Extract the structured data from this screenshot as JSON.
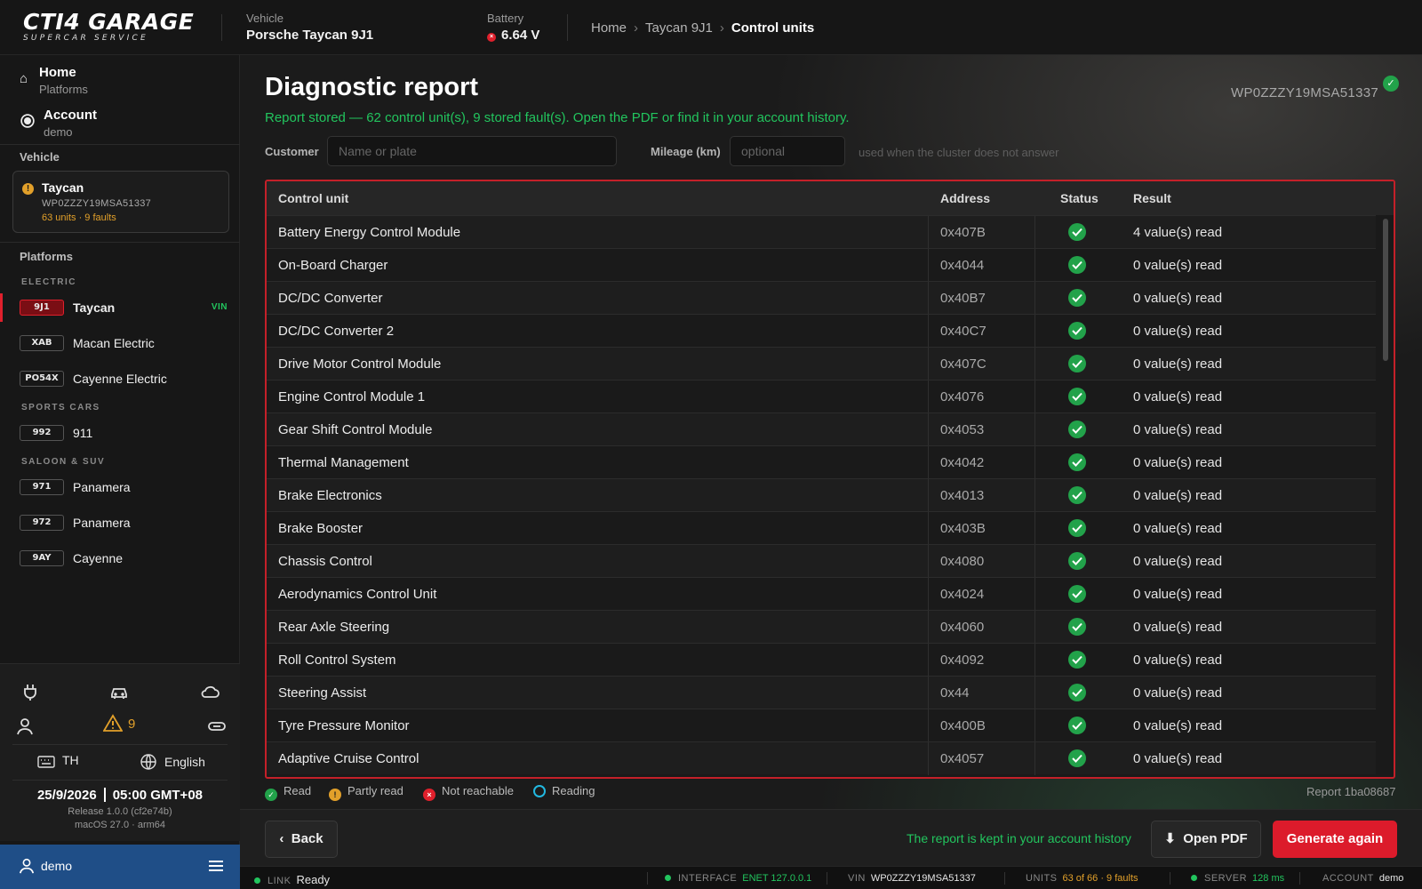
{
  "app": {
    "logo_main": "CTI4 GARAGE",
    "logo_sub": "SUPERCAR SERVICE"
  },
  "topbar": {
    "vehicle_label": "Vehicle",
    "vehicle_value": "Porsche Taycan 9J1",
    "battery_label": "Battery",
    "battery_value": "6.64 V",
    "battery_status_color": "#e0202c",
    "breadcrumb": [
      "Home",
      "Taycan 9J1",
      "Control units"
    ]
  },
  "sidebar": {
    "nav": [
      {
        "title": "Home",
        "sub": "Platforms",
        "icon": "home-icon"
      },
      {
        "title": "Account",
        "sub": "demo",
        "icon": "radio-icon"
      }
    ],
    "vehicle_section": "Vehicle",
    "vehicle_card": {
      "name": "Taycan",
      "vin": "WP0ZZZY19MSA51337",
      "stats": "63 units · 9 faults"
    },
    "platforms_section": "Platforms",
    "groups": {
      "electric": "ELECTRIC",
      "sports": "SPORTS CARS",
      "saloon": "SALOON & SUV"
    },
    "platforms": [
      {
        "code": "9J1",
        "name": "Taycan",
        "tag": "VIN"
      },
      {
        "code": "XAB",
        "name": "Macan Electric"
      },
      {
        "code": "PO54X",
        "name": "Cayenne Electric"
      },
      {
        "code": "992",
        "name": "911"
      },
      {
        "code": "971",
        "name": "Panamera"
      },
      {
        "code": "972",
        "name": "Panamera"
      },
      {
        "code": "9AY",
        "name": "Cayenne"
      }
    ],
    "warning_count": "9",
    "keyboard": "TH",
    "language": "English",
    "date": "25/9/2026",
    "time": "05:00 GMT+08",
    "release": "Release 1.0.0 (cf2e74b)",
    "os": "macOS 27.0 · arm64",
    "user": "demo"
  },
  "main": {
    "title": "Diagnostic report",
    "vin": "WP0ZZZY19MSA51337",
    "notice": "Report stored — 62 control unit(s), 9 stored fault(s). Open the PDF or find it in your account history.",
    "customer_label": "Customer",
    "customer_placeholder": "Name or plate",
    "mileage_label": "Mileage (km)",
    "mileage_placeholder": "optional",
    "mileage_hint": "used when the cluster does not answer",
    "columns": [
      "Control unit",
      "Address",
      "Status",
      "Result"
    ],
    "rows": [
      {
        "name": "Battery Energy Control Module",
        "addr": "0x407B",
        "result": "4 value(s) read"
      },
      {
        "name": "On-Board Charger",
        "addr": "0x4044",
        "result": "0 value(s) read"
      },
      {
        "name": "DC/DC Converter",
        "addr": "0x40B7",
        "result": "0 value(s) read"
      },
      {
        "name": "DC/DC Converter 2",
        "addr": "0x40C7",
        "result": "0 value(s) read"
      },
      {
        "name": "Drive Motor Control Module",
        "addr": "0x407C",
        "result": "0 value(s) read"
      },
      {
        "name": "Engine Control Module 1",
        "addr": "0x4076",
        "result": "0 value(s) read"
      },
      {
        "name": "Gear Shift Control Module",
        "addr": "0x4053",
        "result": "0 value(s) read"
      },
      {
        "name": "Thermal Management",
        "addr": "0x4042",
        "result": "0 value(s) read"
      },
      {
        "name": "Brake Electronics",
        "addr": "0x4013",
        "result": "0 value(s) read"
      },
      {
        "name": "Brake Booster",
        "addr": "0x403B",
        "result": "0 value(s) read"
      },
      {
        "name": "Chassis Control",
        "addr": "0x4080",
        "result": "0 value(s) read"
      },
      {
        "name": "Aerodynamics Control Unit",
        "addr": "0x4024",
        "result": "0 value(s) read"
      },
      {
        "name": "Rear Axle Steering",
        "addr": "0x4060",
        "result": "0 value(s) read"
      },
      {
        "name": "Roll Control System",
        "addr": "0x4092",
        "result": "0 value(s) read"
      },
      {
        "name": "Steering Assist",
        "addr": "0x44",
        "result": "0 value(s) read"
      },
      {
        "name": "Tyre Pressure Monitor",
        "addr": "0x400B",
        "result": "0 value(s) read"
      },
      {
        "name": "Adaptive Cruise Control",
        "addr": "0x4057",
        "result": "0 value(s) read"
      }
    ],
    "legend": {
      "read": "Read",
      "partly": "Partly read",
      "unreachable": "Not reachable",
      "reading": "Reading"
    },
    "report_id": "Report 1ba08687",
    "back_label": "Back",
    "kept_note": "The report is kept in your account history",
    "pdf_label": "Open PDF",
    "generate_label": "Generate again"
  },
  "statusbar": {
    "link_k": "LINK",
    "link_v": "Ready",
    "iface_k": "INTERFACE",
    "iface_v": "ENET 127.0.0.1",
    "vin_k": "VIN",
    "vin_v": "WP0ZZZY19MSA51337",
    "units_k": "UNITS",
    "units_v": "63 of 66 · 9 faults",
    "server_k": "SERVER",
    "server_v": "128 ms",
    "account_k": "ACCOUNT",
    "account_v": "demo"
  },
  "colors": {
    "accent": "#dc1b2b",
    "ok": "#22a24a",
    "warn": "#e2a02a",
    "positive_text": "#22c55e"
  }
}
